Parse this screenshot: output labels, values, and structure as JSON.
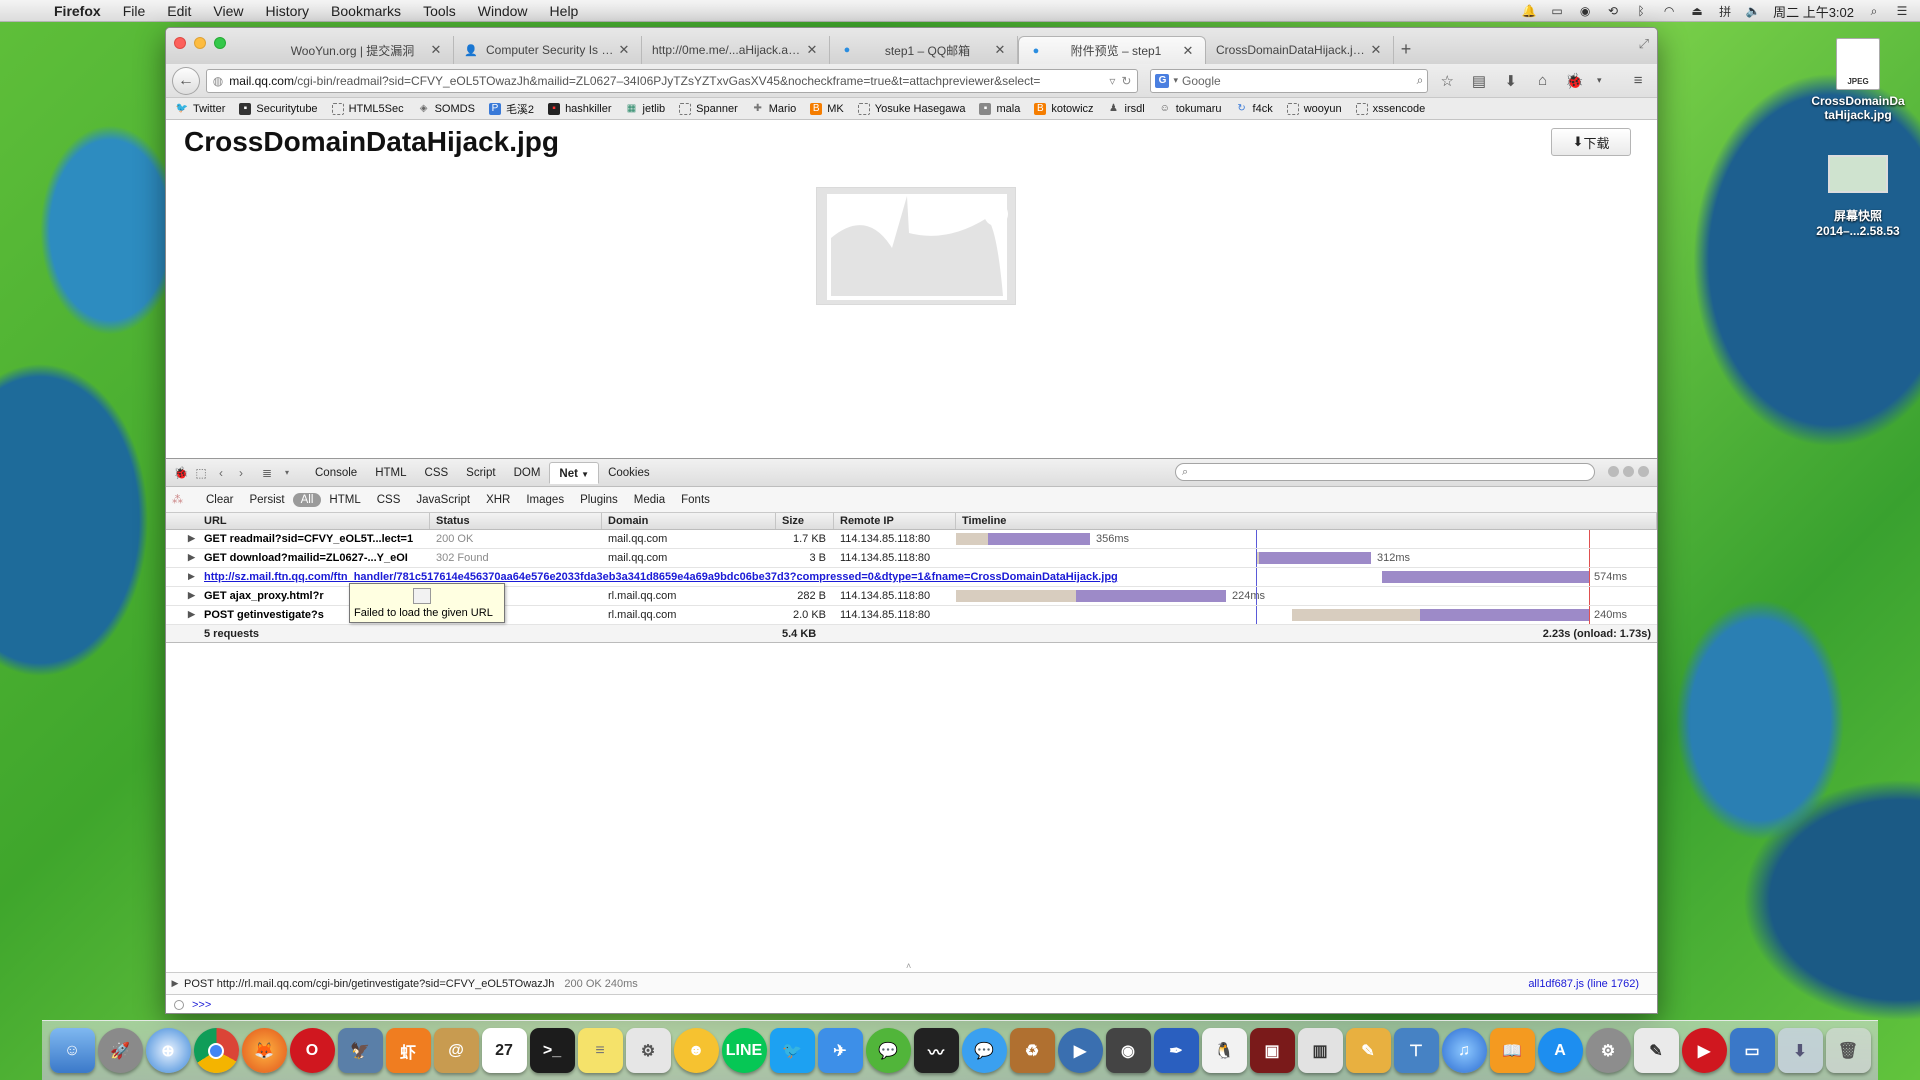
{
  "menubar": {
    "app": "Firefox",
    "items": [
      "File",
      "Edit",
      "View",
      "History",
      "Bookmarks",
      "Tools",
      "Window",
      "Help"
    ],
    "clock": "周二 上午3:02"
  },
  "tabs": [
    {
      "title": "WooYun.org | 提交漏洞",
      "active": false
    },
    {
      "title": "Computer Security Is My I...",
      "active": false
    },
    {
      "title": "http://0me.me/...aHijack.as.txt",
      "active": false
    },
    {
      "title": "step1 – QQ邮箱",
      "active": false
    },
    {
      "title": "附件预览 – step1",
      "active": true
    },
    {
      "title": "CrossDomainDataHijack.jpg (J...",
      "active": false
    }
  ],
  "urlbar": {
    "host": "mail.qq.com",
    "path": "/cgi-bin/readmail?sid=CFVY_eOL5TOwazJh&mailid=ZL0627–34I06PJyTZsYZTxvGasXV45&nocheckframe=true&t=attachpreviewer&select="
  },
  "search": {
    "placeholder": "Google",
    "engine": "G"
  },
  "bookmarks": [
    "Twitter",
    "Securitytube",
    "HTML5Sec",
    "SOMDS",
    "毛溪2",
    "hashkiller",
    "jetlib",
    "Spanner",
    "Mario",
    "MK",
    "Yosuke Hasegawa",
    "mala",
    "kotowicz",
    "irsdl",
    "tokumaru",
    "f4ck",
    "wooyun",
    "xssencode"
  ],
  "page": {
    "title": "CrossDomainDataHijack.jpg",
    "download_label": "下载"
  },
  "firebug": {
    "tabs": [
      "Console",
      "HTML",
      "CSS",
      "Script",
      "DOM",
      "Net",
      "Cookies"
    ],
    "active_tab": "Net",
    "subbar": [
      "Clear",
      "Persist",
      "All",
      "HTML",
      "CSS",
      "JavaScript",
      "XHR",
      "Images",
      "Plugins",
      "Media",
      "Fonts"
    ],
    "active_filter": "All",
    "columns": [
      "URL",
      "Status",
      "Domain",
      "Size",
      "Remote IP",
      "Timeline"
    ],
    "rows": [
      {
        "url": "GET readmail?sid=CFVY_eOL5T...lect=1",
        "status": "200 OK",
        "domain": "mail.qq.com",
        "size": "1.7 KB",
        "ip": "114.134.85.118:80",
        "time": "356ms"
      },
      {
        "url": "GET download?mailid=ZL0627-...Y_eOI",
        "status": "302 Found",
        "domain": "mail.qq.com",
        "size": "3 B",
        "ip": "114.134.85.118:80",
        "time": "312ms"
      },
      {
        "url": "http://sz.mail.ftn.qq.com/ftn_handler/781c517614e456370aa64e576e2033fda3eb3a341d8659e4a69a9bdc06be37d3?compressed=0&dtype=1&fname=CrossDomainDataHijack.jpg",
        "status": "",
        "domain": "",
        "size": "",
        "ip": "",
        "time": "574ms"
      },
      {
        "url": "GET ajax_proxy.html?r",
        "status": "",
        "domain": "rl.mail.qq.com",
        "size": "282 B",
        "ip": "114.134.85.118:80",
        "time": "224ms"
      },
      {
        "url": "POST getinvestigate?s",
        "status": "",
        "domain": "rl.mail.qq.com",
        "size": "2.0 KB",
        "ip": "114.134.85.118:80",
        "time": "240ms"
      }
    ],
    "footer": {
      "requests": "5 requests",
      "size": "5.4 KB",
      "total": "2.23s (onload: 1.73s)"
    },
    "tooltip": "Failed to load the given URL",
    "console_line": {
      "text": "POST http://rl.mail.qq.com/cgi-bin/getinvestigate?sid=CFVY_eOL5TOwazJh",
      "status": "200 OK 240ms",
      "source": "all1df687.js (line 1762)"
    },
    "cmd_prompt": ">>>"
  },
  "desktop": {
    "icon1": "CrossDomainDataHijack.jpg",
    "icon1_line1": "CrossDomainDa",
    "icon1_line2": "taHijack.jpg",
    "icon1_badge": "JPEG",
    "icon2_line1": "屏幕快照",
    "icon2_line2": "2014–...2.58.53"
  }
}
